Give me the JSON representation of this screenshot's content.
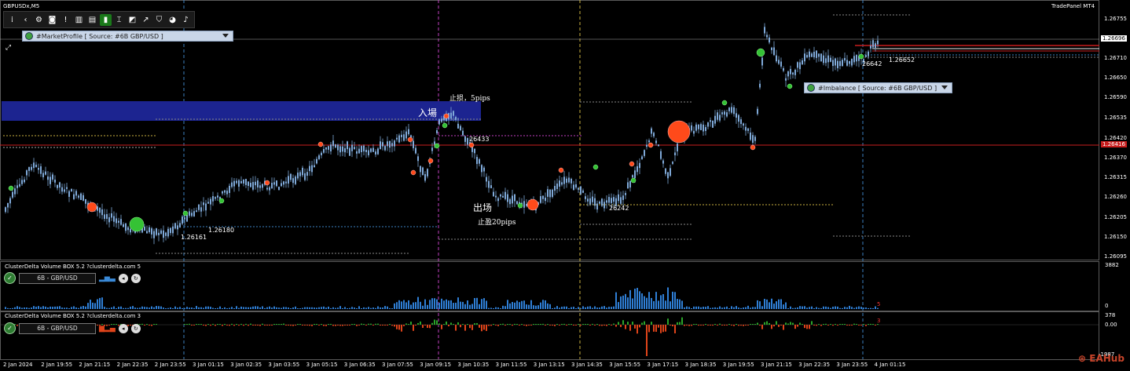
{
  "window": {
    "symbol": "GBPUSDx,M5",
    "panel_title": "TradePanel MT4"
  },
  "toolbar": {
    "icons": [
      "grip-icon",
      "back-arrow-icon",
      "gear-icon",
      "camera-icon",
      "info-icon",
      "bar-chart-icon",
      "list-icon",
      "green-chart-icon",
      "crosshair-icon",
      "zoom-icon",
      "trend-icon",
      "shield-icon",
      "pie-icon",
      "bell-icon"
    ]
  },
  "main": {
    "profile_combo": "#MarketProfile [ Source: #6B GBP/USD ]",
    "imbalance_combo": "#Imbalance [ Source: #6B GBP/USD ]",
    "current_price": "1.26696",
    "red_line_price": "1.26416",
    "y_ticks": [
      "1.26755",
      "1.26710",
      "1.26650",
      "1.26590",
      "1.26535",
      "1.26480",
      "1.26420",
      "1.26370",
      "1.26315",
      "1.26260",
      "1.26205",
      "1.26150",
      "1.26095"
    ],
    "annotations": {
      "entry": "入場",
      "stop_loss": "止损，5pips",
      "exit": "出场",
      "take_profit": "止盈20pips",
      "p26433": "26433",
      "p26161": "1.26161",
      "p26180": "1.26180",
      "p26242": "26242",
      "p26642": "26642",
      "p26652": "1.26652"
    }
  },
  "sub1": {
    "title": "ClusterDelta Volume BOX 5.2 ?clusterdelta.com 5",
    "instrument": "6B - GBP/USD",
    "y_top": "3882",
    "y_bottom": "0",
    "marker": "5"
  },
  "sub2": {
    "title": "ClusterDelta Volume BOX 5.2 ?clusterdelta.com 3",
    "instrument": "6B - GBP/USD",
    "y_top": "378",
    "y_mid": "0.00",
    "y_bottom": "-1987",
    "marker": "3"
  },
  "x_axis": [
    "2 Jan 2024",
    "2 Jan 19:55",
    "2 Jan 21:15",
    "2 Jan 22:35",
    "2 Jan 23:55",
    "3 Jan 01:15",
    "3 Jan 02:35",
    "3 Jan 03:55",
    "3 Jan 05:15",
    "3 Jan 06:35",
    "3 Jan 07:55",
    "3 Jan 09:15",
    "3 Jan 10:35",
    "3 Jan 11:55",
    "3 Jan 13:15",
    "3 Jan 14:35",
    "3 Jan 15:55",
    "3 Jan 17:15",
    "3 Jan 18:35",
    "3 Jan 19:55",
    "3 Jan 21:15",
    "3 Jan 22:35",
    "3 Jan 23:55",
    "4 Jan 01:15"
  ],
  "watermark": "EAHub",
  "colors": {
    "candle": "#7fa9d8",
    "red_line": "#c81e1e",
    "entry_box": "#1c2490",
    "buy_dot": "#35c235",
    "sell_dot": "#ff4a1a",
    "vol_bar": "#2f7fd6",
    "delta_pos": "#2aa52a",
    "delta_neg": "#e0441a"
  }
}
